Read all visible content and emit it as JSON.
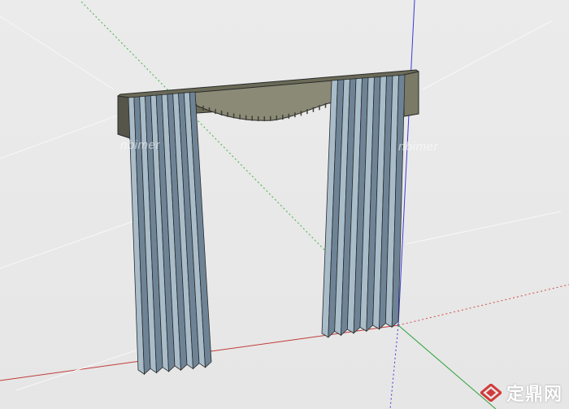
{
  "app": {
    "type": "3d-modeling-viewport",
    "model": "curtain with pelmet and valance"
  },
  "axes": {
    "red": "#d44a4a",
    "green": "#3cb043",
    "blue": "#3a3ad8"
  },
  "colors": {
    "background": "#e9e9e9",
    "curtain_fabric": "#a9bcc9",
    "curtain_shadow": "#6e8496",
    "pelmet": "#6a6a58",
    "valance": "#8a8a76",
    "tassel": "#3e3e34",
    "edge": "#2a2a2a"
  },
  "watermarks": {
    "left": "nbimer",
    "right": "nbimer"
  },
  "branding": {
    "logo_name": "zhulong-logo-icon",
    "text": "定鼎网"
  }
}
